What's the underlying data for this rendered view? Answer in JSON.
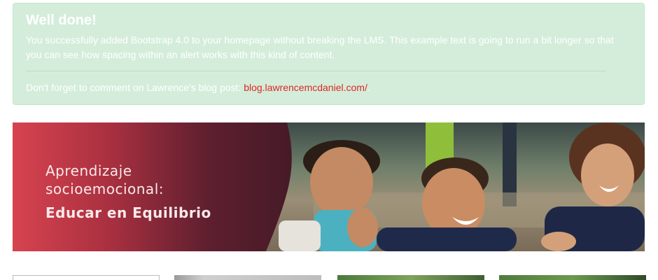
{
  "alert": {
    "heading": "Well done!",
    "paragraph": "You successfully added Bootstrap 4.0 to your homepage without breaking the LMS. This example text is going to run a bit longer so that you can see how spacing within an alert works with this kind of content.",
    "footer_prefix": "Don't forget to comment on Lawrence's blog post: ",
    "footer_link": "blog.lawrencemcdaniel.com/",
    "footer_suffix": ".",
    "colors": {
      "background": "#d4edda",
      "text": "#ffffff",
      "link": "#dc2626"
    }
  },
  "banner": {
    "line1": "Aprendizaje",
    "line2": "socioemocional:",
    "line3": "Educar en Equilibrio",
    "image": "photo of three smiling children in school uniforms"
  },
  "cards": [
    {
      "thumbnail": "white card with gray border"
    },
    {
      "thumbnail": "gray image thumbnail"
    },
    {
      "thumbnail": "green image thumbnail"
    },
    {
      "thumbnail": "green image thumbnail"
    }
  ]
}
